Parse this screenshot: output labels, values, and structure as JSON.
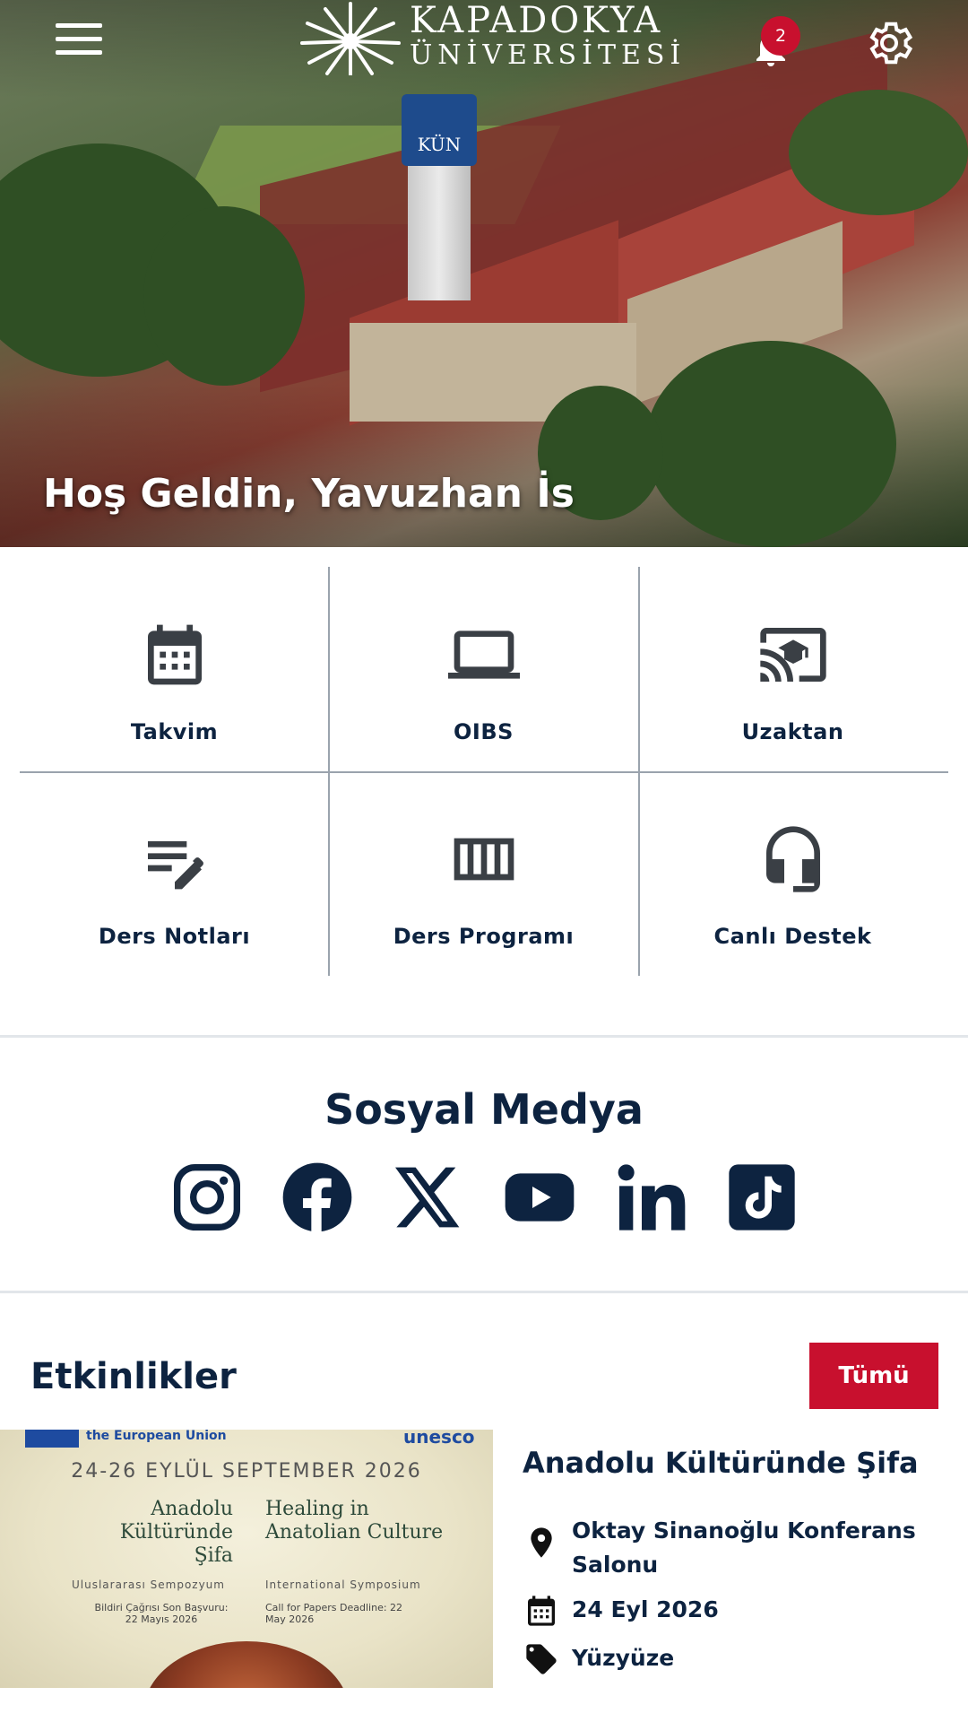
{
  "header": {
    "logo_line1": "KAPADOKYA",
    "logo_line2": "ÜNİVERSİTESİ",
    "notification_count": "2",
    "welcome": "Hoş Geldin, Yavuzhan İs",
    "logo_tower_text": "KÜN"
  },
  "quick_links": [
    {
      "label": "Takvim",
      "icon": "calendar-icon"
    },
    {
      "label": "OIBS",
      "icon": "laptop-icon"
    },
    {
      "label": "Uzaktan",
      "icon": "cast-education-icon"
    },
    {
      "label": "Ders Notları",
      "icon": "notes-edit-icon"
    },
    {
      "label": "Ders Programı",
      "icon": "schedule-columns-icon"
    },
    {
      "label": "Canlı Destek",
      "icon": "headset-icon"
    }
  ],
  "social": {
    "title": "Sosyal Medya",
    "items": [
      "instagram-icon",
      "facebook-icon",
      "x-icon",
      "youtube-icon",
      "linkedin-icon",
      "tiktok-icon"
    ]
  },
  "events": {
    "title": "Etkinlikler",
    "all_label": "Tümü",
    "item": {
      "title": "Anadolu Kültüründe Şifa",
      "location": "Oktay Sinanoğlu Konferans Salonu",
      "date": "24 Eyl 2026",
      "mode": "Yüzyüze",
      "poster": {
        "eu": "the European Union",
        "unesco": "unesco",
        "dates": "24-26 EYLÜL SEPTEMBER 2026",
        "title_tr": "Anadolu Kültüründe Şifa",
        "title_en": "Healing in Anatolian Culture",
        "symposium_tr": "Uluslararası Sempozyum",
        "symposium_en": "International Symposium",
        "cfp_tr": "Bildiri Çağrısı Son Başvuru: 22 Mayıs 2026",
        "cfp_en": "Call for Papers Deadline: 22 May 2026"
      }
    }
  },
  "colors": {
    "primary": "#0d2340",
    "accent": "#c8102e",
    "divider": "#e2e6ea",
    "grid_line": "#9aa3ad"
  }
}
